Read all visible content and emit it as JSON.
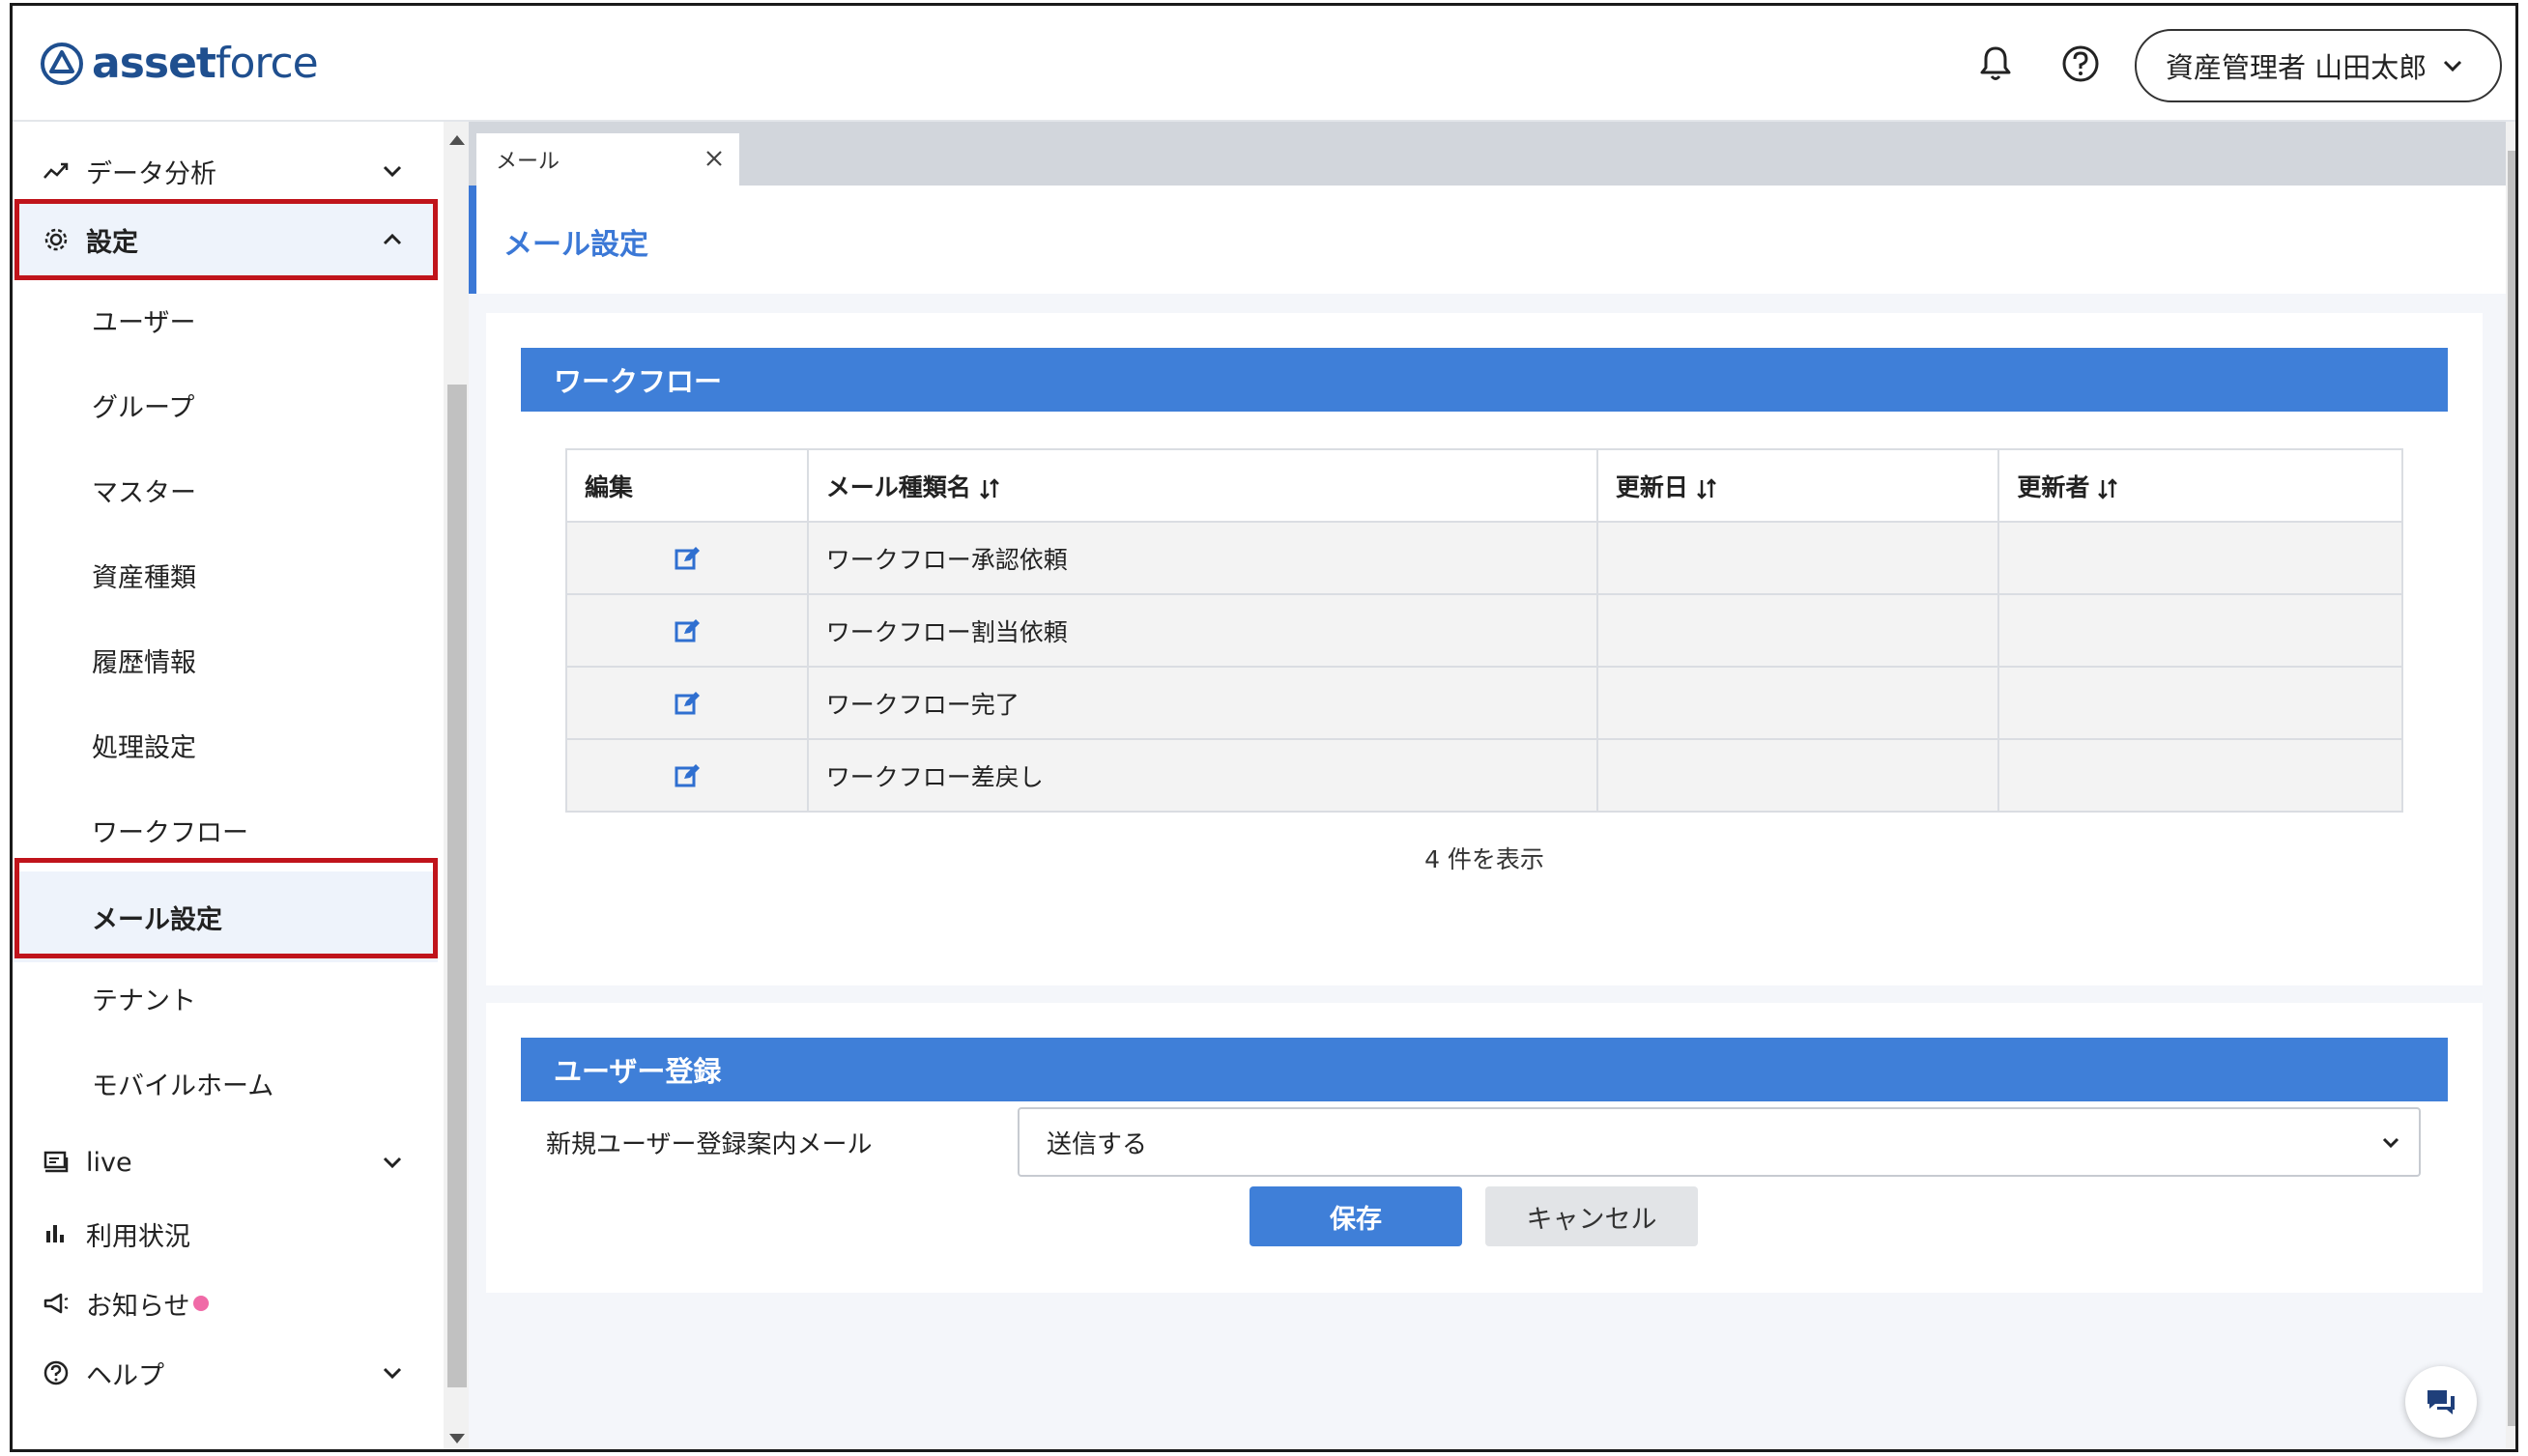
{
  "header": {
    "logo_text_a": "asset",
    "logo_text_b": "force",
    "user_label": "資産管理者 山田太郎"
  },
  "sidebar": {
    "top_items": [
      {
        "label": "データ分析",
        "icon": "chart-line-icon"
      },
      {
        "label": "設定",
        "icon": "gear-icon"
      }
    ],
    "sub_items": [
      "ユーザー",
      "グループ",
      "マスター",
      "資産種類",
      "履歴情報",
      "処理設定",
      "ワークフロー",
      "メール設定",
      "テナント",
      "モバイルホーム"
    ],
    "bottom_items": [
      {
        "label": "live",
        "icon": "live-icon"
      },
      {
        "label": "利用状況",
        "icon": "bar-chart-icon"
      },
      {
        "label": "お知らせ",
        "icon": "megaphone-icon"
      },
      {
        "label": "ヘルプ",
        "icon": "help-circle-icon"
      }
    ]
  },
  "tab": {
    "label": "メール"
  },
  "page_title": "メール設定",
  "workflow": {
    "heading": "ワークフロー",
    "columns": [
      "編集",
      "メール種類名",
      "更新日",
      "更新者"
    ],
    "rows": [
      {
        "name": "ワークフロー承認依頼",
        "updated": "",
        "updater": ""
      },
      {
        "name": "ワークフロー割当依頼",
        "updated": "",
        "updater": ""
      },
      {
        "name": "ワークフロー完了",
        "updated": "",
        "updater": ""
      },
      {
        "name": "ワークフロー差戻し",
        "updated": "",
        "updater": ""
      }
    ],
    "count_text": "4 件を表示"
  },
  "user_registration": {
    "heading": "ユーザー登録",
    "field_label": "新規ユーザー登録案内メール",
    "select_value": "送信する",
    "save_label": "保存",
    "cancel_label": "キャンセル"
  },
  "colors": {
    "accent": "#3f7fd8",
    "highlight_border": "#c0141b",
    "notification_dot": "#f06aa7"
  }
}
